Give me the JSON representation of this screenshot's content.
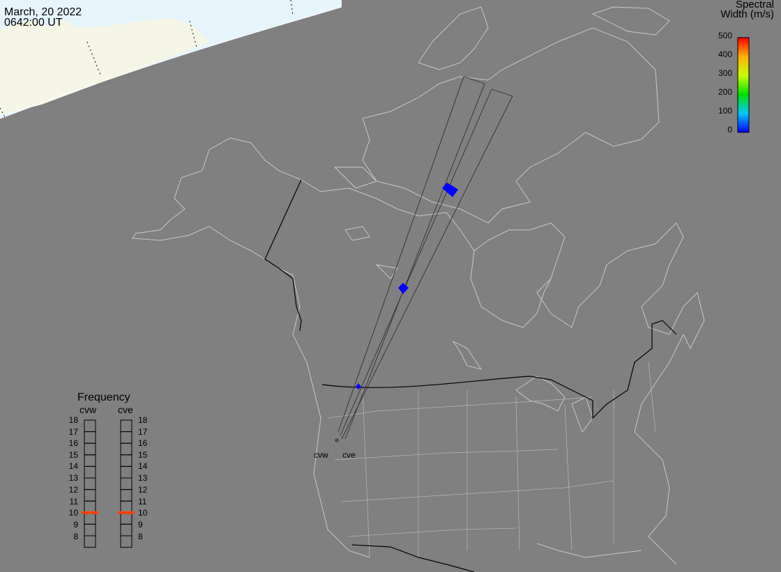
{
  "header": {
    "date": "March, 20 2022",
    "time": "0642:00 UT"
  },
  "colorbar": {
    "title_line1": "Spectral",
    "title_line2": "Width (m/s)",
    "ticks": [
      "500",
      "400",
      "300",
      "200",
      "100",
      "0"
    ],
    "range": [
      0,
      500
    ],
    "colors": [
      "#0000ff",
      "#00c8ff",
      "#00e000",
      "#c8ff00",
      "#ffb000",
      "#ff0000"
    ]
  },
  "frequency_panel": {
    "title": "Frequency",
    "radars": [
      {
        "name": "cvw",
        "selected": 10.5
      },
      {
        "name": "cve",
        "selected": 10.5
      }
    ],
    "scale": [
      "18",
      "17",
      "16",
      "15",
      "14",
      "13",
      "12",
      "11",
      "10",
      "9",
      "8"
    ],
    "marker_color": "#ff4000"
  },
  "sites": {
    "cvw_label": "cvw",
    "cve_label": "cve"
  },
  "colors": {
    "ocean_land": "#808080",
    "daylight_region": "#e6f4fc",
    "daylight_land": "#f6f6e6",
    "coastline": "#c8c8c8",
    "border": "#000000",
    "echo": "#0000ff"
  }
}
